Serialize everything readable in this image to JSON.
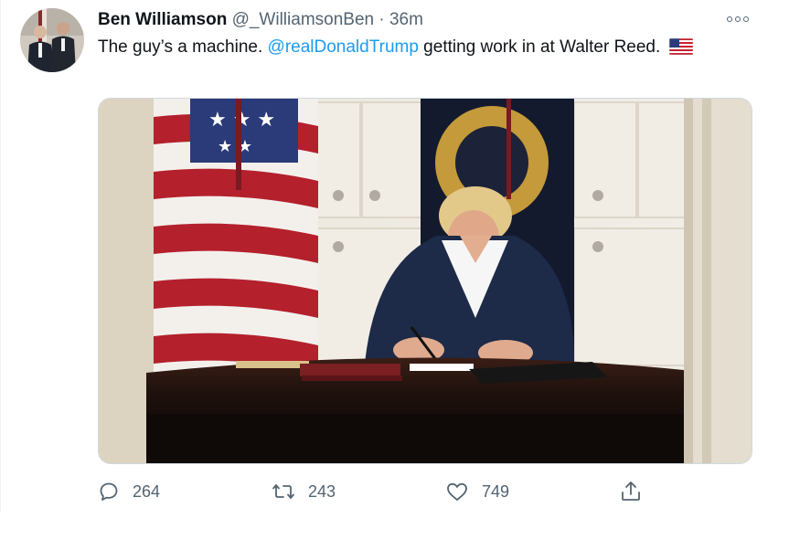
{
  "author": {
    "display_name": "Ben Williamson",
    "handle": "@_WilliamsonBen",
    "separator": "·",
    "time": "36m"
  },
  "tweet": {
    "text_before": "The guy’s a machine. ",
    "mention": "@realDonaldTrump",
    "text_after": " getting work in at Walter Reed.",
    "flag_icon": "us-flag-emoji"
  },
  "actions": {
    "reply_count": "264",
    "retweet_count": "243",
    "like_count": "749"
  },
  "colors": {
    "link": "#1d9bf0",
    "secondary_text": "#536471",
    "primary_text": "#0f1419"
  }
}
